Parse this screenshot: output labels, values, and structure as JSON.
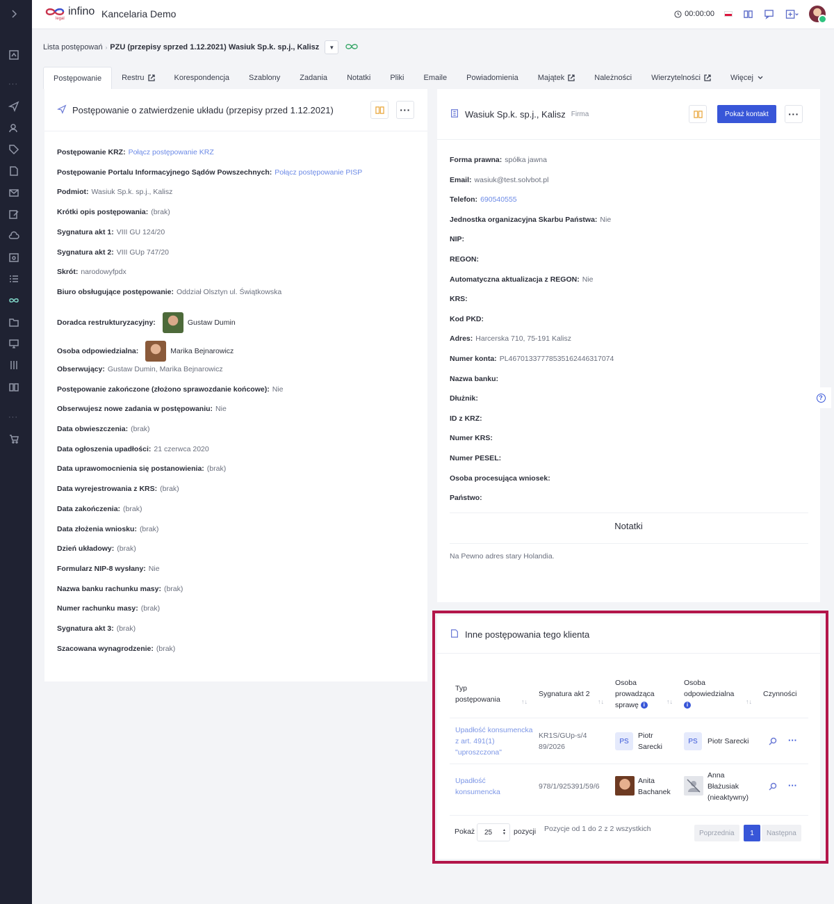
{
  "topbar": {
    "logo_text": "infino",
    "logo_sub": "legal",
    "company": "Kancelaria Demo",
    "timer": "00:00:00"
  },
  "breadcrumb": {
    "root": "Lista postępowań",
    "current": "PZU (przepisy sprzed 1.12.2021) Wasiuk Sp.k. sp.j., Kalisz"
  },
  "tabs": [
    {
      "label": "Postępowanie"
    },
    {
      "label": "Restru"
    },
    {
      "label": "Korespondencja"
    },
    {
      "label": "Szablony"
    },
    {
      "label": "Zadania"
    },
    {
      "label": "Notatki"
    },
    {
      "label": "Pliki"
    },
    {
      "label": "Emaile"
    },
    {
      "label": "Powiadomienia"
    },
    {
      "label": "Majątek"
    },
    {
      "label": "Należności"
    },
    {
      "label": "Wierzytelności"
    },
    {
      "label": "Więcej"
    }
  ],
  "case": {
    "title": "Postępowanie o zatwierdzenie układu (przepisy przed 1.12.2021)",
    "fields": [
      {
        "label": "Postępowanie KRZ:",
        "value": "Połącz postępowanie KRZ"
      },
      {
        "label": "Postępowanie Portalu Informacyjnego Sądów Powszechnych:",
        "value": "Połącz postępowanie PISP"
      },
      {
        "label": "Podmiot:",
        "value": "Wasiuk Sp.k. sp.j., Kalisz"
      },
      {
        "label": "Krótki opis postępowania:",
        "value": "(brak)"
      },
      {
        "label": "Sygnatura akt 1:",
        "value": "VIII GU 124/20"
      },
      {
        "label": "Sygnatura akt 2:",
        "value": "VIII GUp 747/20"
      },
      {
        "label": "Skrót:",
        "value": "narodowyfpdx"
      },
      {
        "label": "Biuro obsługujące postępowanie:",
        "value": "Oddział Olsztyn ul. Świątkowska"
      },
      {
        "label": "Doradca restrukturyzacyjny:",
        "value": "Gustaw Dumin"
      },
      {
        "label": "Osoba odpowiedzialna:",
        "value": "Marika Bejnarowicz"
      },
      {
        "label": "Obserwujący:",
        "value": "Gustaw Dumin, Marika Bejnarowicz"
      },
      {
        "label": "Postępowanie zakończone (złożono sprawozdanie końcowe):",
        "value": "Nie"
      },
      {
        "label": "Obserwujesz nowe zadania w postępowaniu:",
        "value": "Nie"
      },
      {
        "label": "Data obwieszczenia:",
        "value": "(brak)"
      },
      {
        "label": "Data ogłoszenia upadłości:",
        "value": "21 czerwca 2020"
      },
      {
        "label": "Data uprawomocnienia się postanowienia:",
        "value": "(brak)"
      },
      {
        "label": "Data wyrejestrowania z KRS:",
        "value": "(brak)"
      },
      {
        "label": "Data zakończenia:",
        "value": "(brak)"
      },
      {
        "label": "Data złożenia wniosku:",
        "value": "(brak)"
      },
      {
        "label": "Dzień układowy:",
        "value": "(brak)"
      },
      {
        "label": "Formularz NIP-8 wysłany:",
        "value": "Nie"
      },
      {
        "label": "Nazwa banku rachunku masy:",
        "value": "(brak)"
      },
      {
        "label": "Numer rachunku masy:",
        "value": "(brak)"
      },
      {
        "label": "Sygnatura akt 3:",
        "value": "(brak)"
      },
      {
        "label": "Szacowana wynagrodzenie:",
        "value": "(brak)"
      }
    ]
  },
  "client": {
    "name": "Wasiuk Sp.k. sp.j., Kalisz",
    "type": "Firma",
    "show_contact": "Pokaż kontakt",
    "fields": [
      {
        "label": "Forma prawna:",
        "value": "spółka jawna"
      },
      {
        "label": "Email:",
        "value": "wasiuk@test.solvbot.pl"
      },
      {
        "label": "Telefon:",
        "value": "690540555"
      },
      {
        "label": "Jednostka organizacyjna Skarbu Państwa:",
        "value": "Nie"
      },
      {
        "label": "NIP:",
        "value": ""
      },
      {
        "label": "REGON:",
        "value": ""
      },
      {
        "label": "Automatyczna aktualizacja z REGON:",
        "value": "Nie"
      },
      {
        "label": "KRS:",
        "value": ""
      },
      {
        "label": "Kod PKD:",
        "value": ""
      },
      {
        "label": "Adres:",
        "value": "Harcerska 710, 75-191 Kalisz"
      },
      {
        "label": "Numer konta:",
        "value": "PL46701337778535162446317074"
      },
      {
        "label": "Nazwa banku:",
        "value": ""
      },
      {
        "label": "Dłużnik:",
        "value": ""
      },
      {
        "label": "ID z KRZ:",
        "value": ""
      },
      {
        "label": "Numer KRS:",
        "value": ""
      },
      {
        "label": "Numer PESEL:",
        "value": ""
      },
      {
        "label": "Osoba procesująca wniosek:",
        "value": ""
      },
      {
        "label": "Państwo:",
        "value": ""
      }
    ],
    "notes_title": "Notatki",
    "note": "Na Pewno adres stary Holandia."
  },
  "other_cases": {
    "title": "Inne postępowania tego klienta",
    "headers": {
      "type": "Typ postępowania",
      "sig": "Sygnatura akt 2",
      "lead": "Osoba prowadząca sprawę",
      "resp": "Osoba odpowiedzialna",
      "actions": "Czynności"
    },
    "rows": [
      {
        "type": "Upadłość konsumencka z art. 491(1) \"uproszczona\"",
        "sig": "KR1S/GUp-s/489/2026",
        "lead_initials": "PS",
        "lead": "Piotr Sarecki",
        "resp_initials": "PS",
        "resp": "Piotr Sarecki"
      },
      {
        "type": "Upadłość konsumencka",
        "sig": "978/1/925391/59/6",
        "lead": "Anita Bachanek",
        "resp": "Anna Błażusiak (nieaktywny)"
      }
    ],
    "show_label": "Pokaż",
    "page_size": "25",
    "items_label": "pozycji",
    "summary": "Pozycje od 1 do 2 z 2 wszystkich",
    "prev": "Poprzednia",
    "page": "1",
    "next": "Następna"
  },
  "colors": {
    "primary": "#3856d8",
    "sidebar": "#1f2232",
    "highlight": "#b3164a",
    "link": "#6c8ae6"
  }
}
